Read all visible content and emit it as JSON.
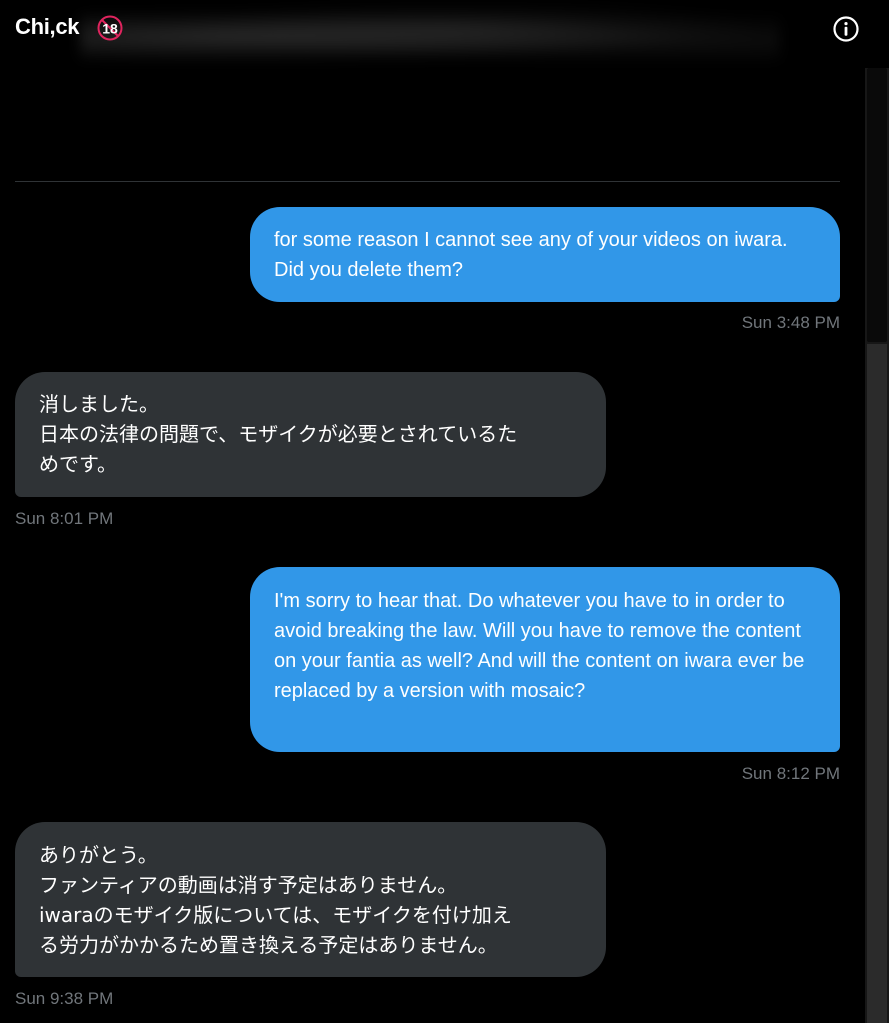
{
  "header": {
    "title": "Chi,ck",
    "age_badge": "18",
    "info_icon": "info-icon"
  },
  "messages": [
    {
      "direction": "sent",
      "text": "for some reason I cannot see any of your videos on iwara. Did you delete them?",
      "time": "Sun 3:48 PM"
    },
    {
      "direction": "received",
      "text": "消しました。\n日本の法律の問題で、モザイクが必要とされているた\nめです。",
      "time": "Sun 8:01 PM"
    },
    {
      "direction": "sent",
      "text": "I'm sorry to hear that. Do whatever you have to in order to avoid breaking the law. Will you have to remove the content on your fantia as well? And will the content on iwara ever be replaced by a version with mosaic?",
      "time": "Sun 8:12 PM"
    },
    {
      "direction": "received",
      "text": "ありがとう。\nファンティアの動画は消す予定はありません。\niwaraのモザイク版については、モザイクを付け加え\nる労力がかかるため置き換える予定はありません。",
      "time": "Sun 9:38 PM"
    }
  ],
  "colors": {
    "sent_bubble": "#3197e8",
    "received_bubble": "#2f3336",
    "timestamp": "#71767b",
    "background": "#000000"
  }
}
